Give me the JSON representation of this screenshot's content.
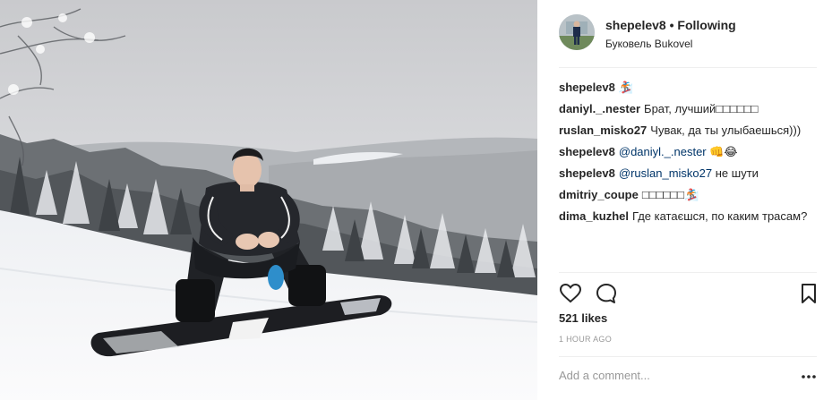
{
  "post": {
    "username": "shepelev8",
    "separator": "•",
    "follow_status": "Following",
    "location": "Буковель Bukovel",
    "avatar_icon": "profile-photo",
    "photo_description_icon": "snowboarder-photo"
  },
  "comments": [
    {
      "user": "shepelev8",
      "text": "🏂"
    },
    {
      "user": "daniyl._.nester",
      "text": "Брат, лучший□□□□□□"
    },
    {
      "user": "ruslan_misko27",
      "text": "Чувак, да ты улыбаешься)))"
    },
    {
      "user": "shepelev8",
      "mention": "@daniyl._.nester",
      "text": "👊😂"
    },
    {
      "user": "shepelev8",
      "mention": "@ruslan_misko27",
      "text": "не шути"
    },
    {
      "user": "dmitriy_coupe",
      "text": "□□□□□□🏂"
    },
    {
      "user": "dima_kuzhel",
      "text": "Где катаєшся, по каким трасам?"
    }
  ],
  "actions": {
    "like_icon": "heart-icon",
    "comment_icon": "comment-icon",
    "save_icon": "bookmark-icon"
  },
  "likes": "521 likes",
  "timestamp": "1 HOUR AGO",
  "add_comment": {
    "placeholder": "Add a comment...",
    "more_icon": "more-options-icon"
  },
  "colors": {
    "text": "#262626",
    "muted": "#999999",
    "mention": "#003569",
    "divider": "#efefef"
  }
}
